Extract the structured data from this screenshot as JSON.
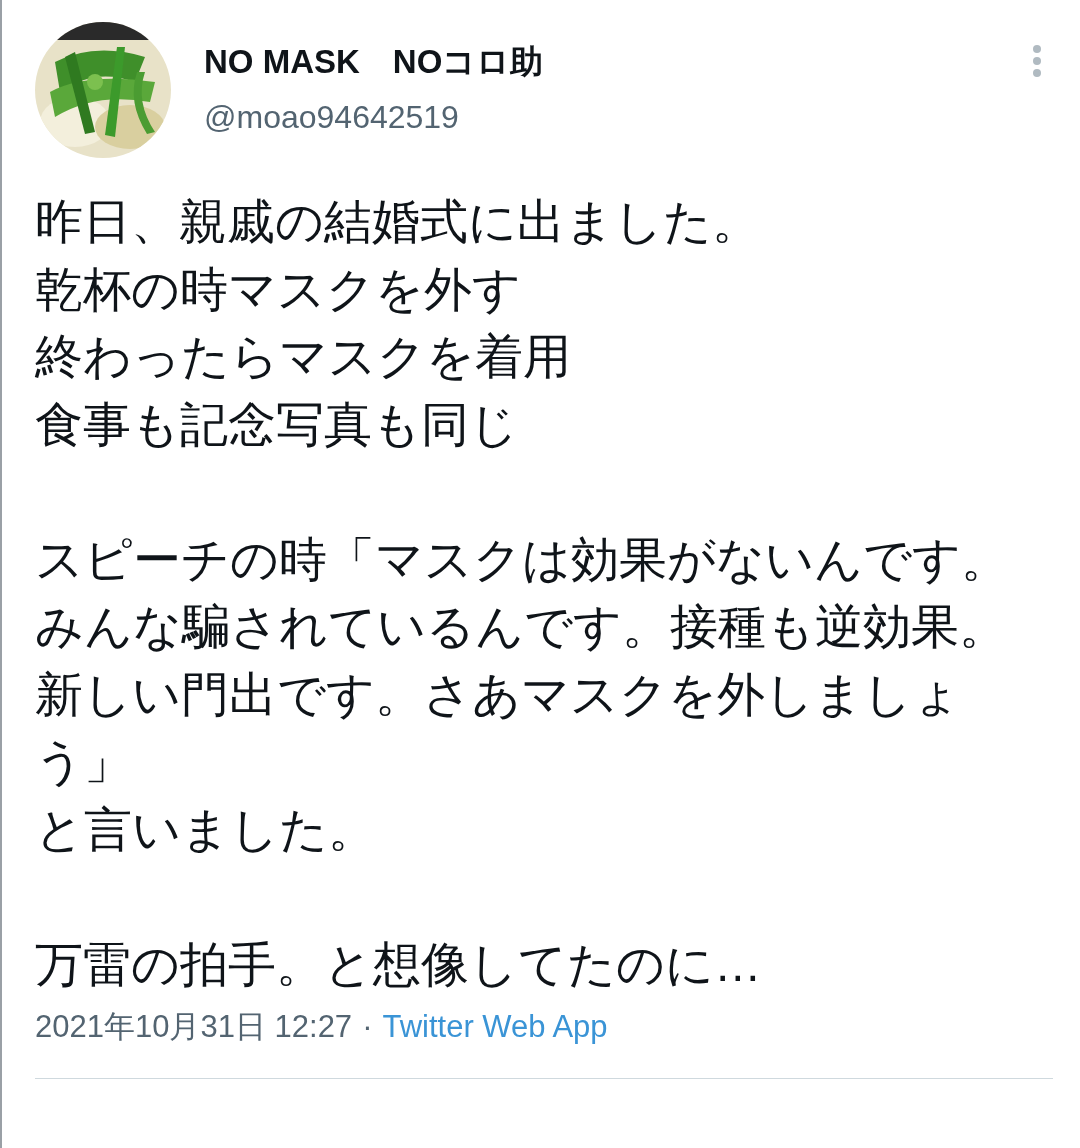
{
  "author": {
    "name": "NO MASK　NOコロ助",
    "handle": "@moao94642519"
  },
  "paragraphs": [
    [
      "昨日、親戚の結婚式に出ました。",
      "乾杯の時マスクを外す",
      "終わったらマスクを着用",
      "食事も記念写真も同じ"
    ],
    [
      "スピーチの時「マスクは効果がないんです。",
      "みんな騙されているんです。接種も逆効果。",
      "新しい門出です。さあマスクを外しましょ",
      "う」",
      "と言いました。"
    ],
    [
      "万雷の拍手。と想像してたのに…"
    ]
  ],
  "footer": {
    "timestamp": "2021年10月31日 12:27",
    "separator": "·",
    "source": "Twitter Web App"
  }
}
